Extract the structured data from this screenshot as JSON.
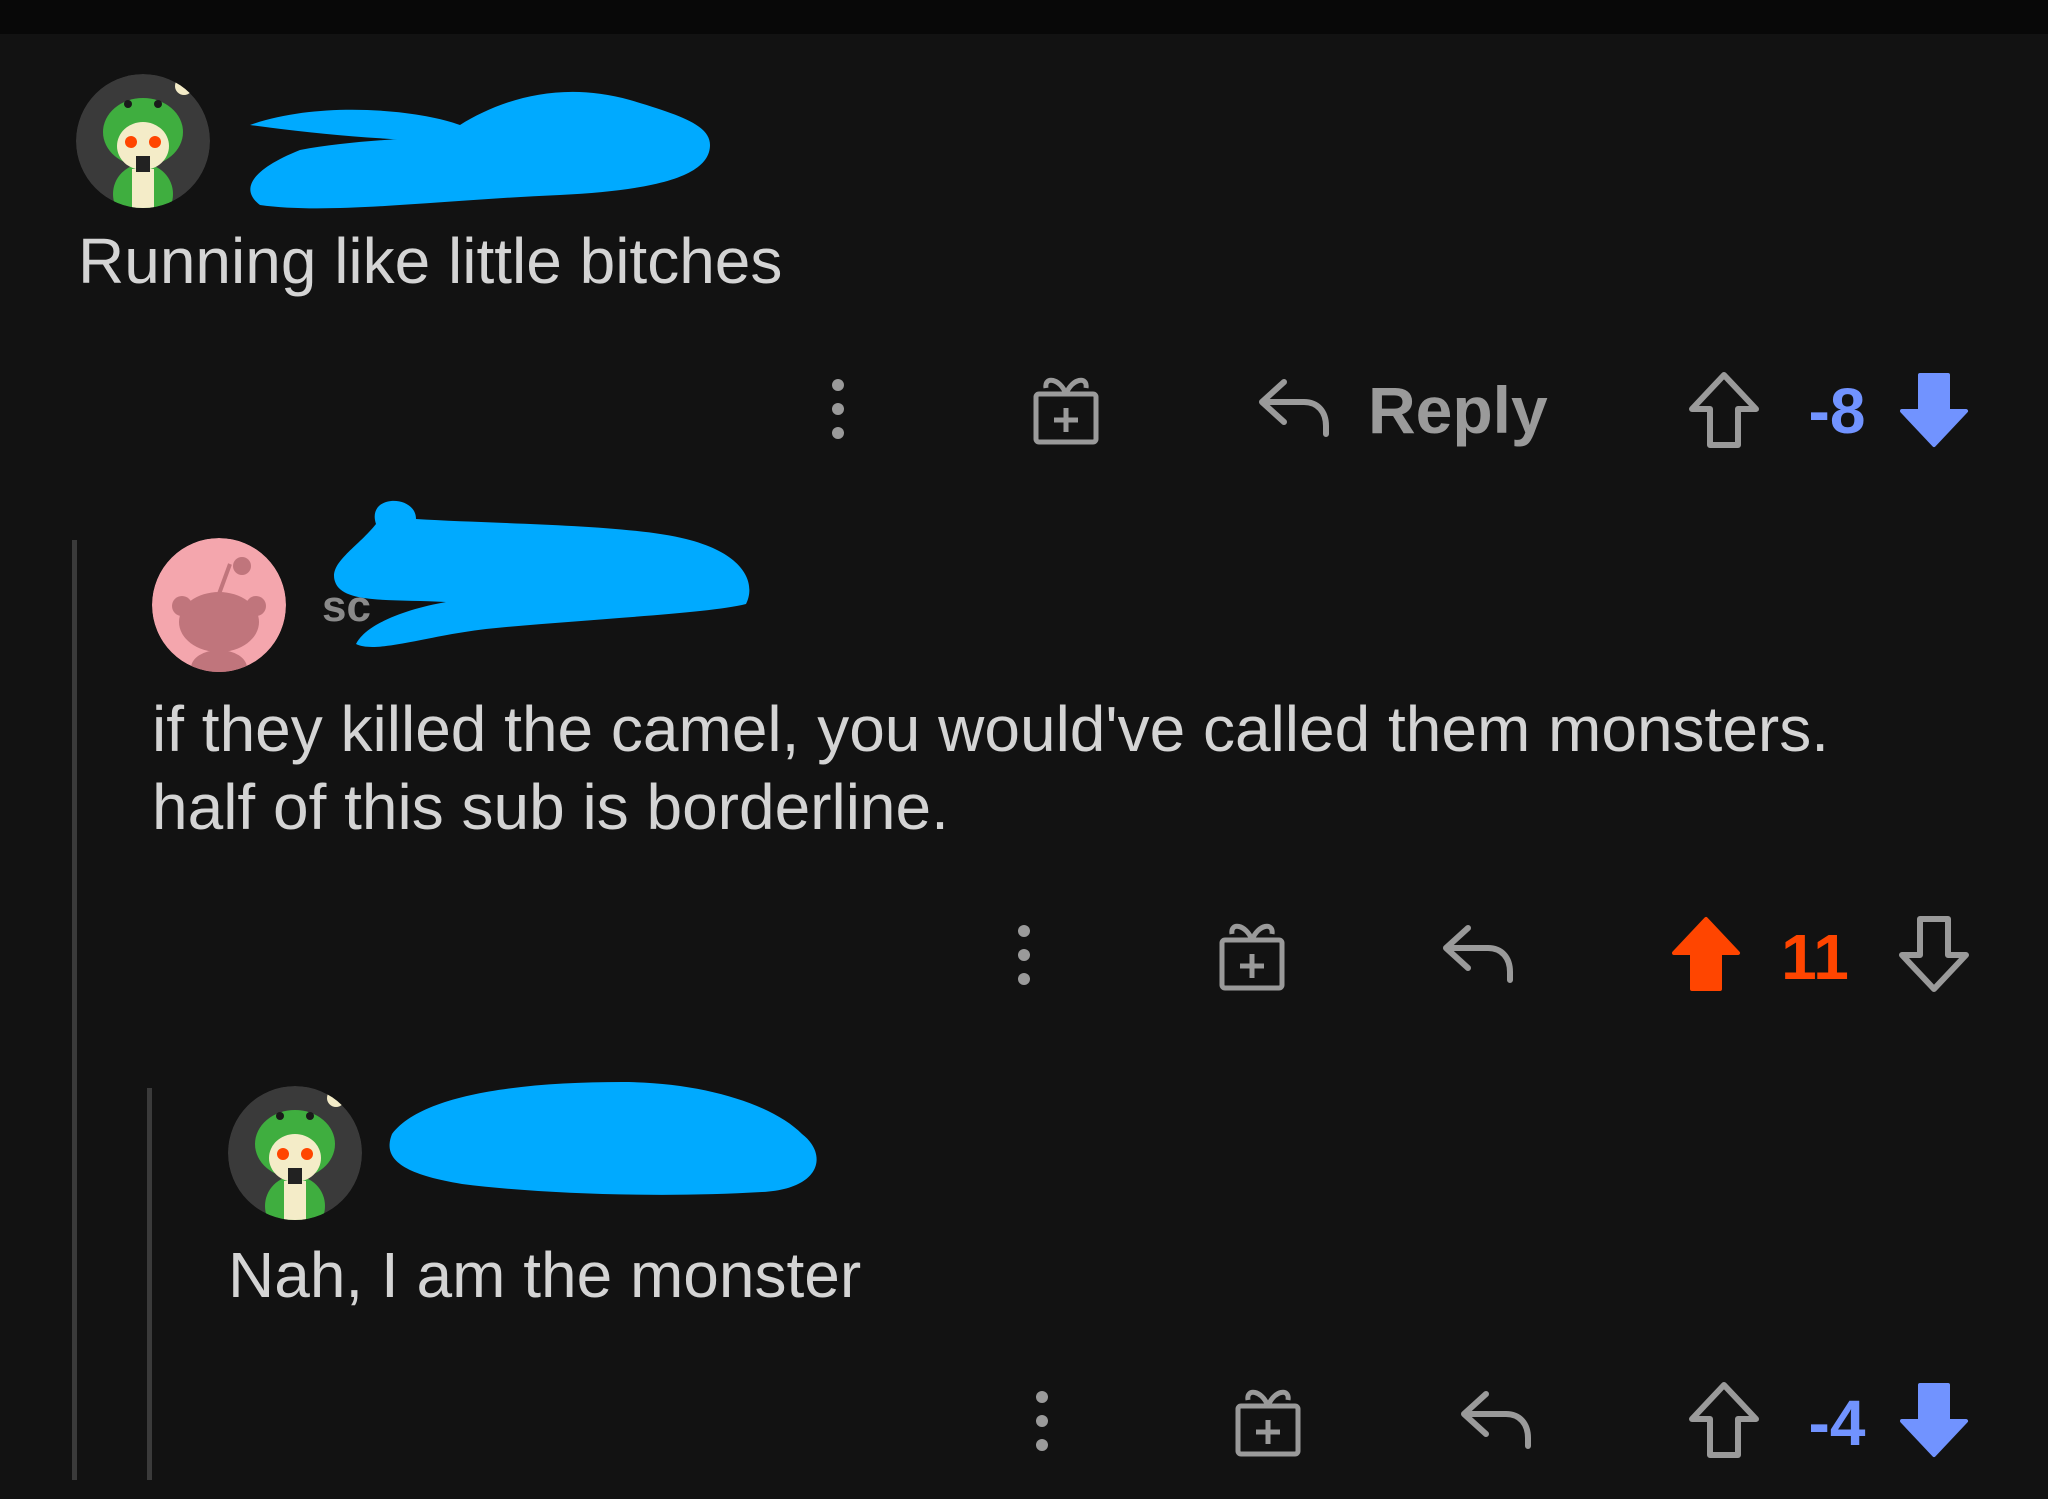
{
  "colors": {
    "background": "#121212",
    "text": "#d4d4d4",
    "muted": "#9a9a9a",
    "downvote": "#7193ff",
    "upvote": "#ff4500",
    "redaction": "#00aaff",
    "thread_line": "#3a3a3a"
  },
  "comments": [
    {
      "username_visible": "",
      "username_redacted": true,
      "avatar": "snoo-frog-hood-avatar",
      "body": "Running like little bitches",
      "actions": {
        "more_icon": "more-vertical-icon",
        "award_icon": "award-gift-icon",
        "reply_icon": "reply-arrow-icon",
        "reply_label": "Reply",
        "score": "-8",
        "vote_state": "downvoted"
      }
    },
    {
      "username_visible": "sc",
      "username_redacted": true,
      "avatar": "default-snoo-pink-avatar",
      "body": "if they killed the camel, you would've called them monsters.\nhalf of this sub is borderline.",
      "actions": {
        "more_icon": "more-vertical-icon",
        "award_icon": "award-gift-icon",
        "reply_icon": "reply-arrow-icon",
        "reply_label": "",
        "score": "11",
        "vote_state": "upvoted"
      }
    },
    {
      "username_visible": "",
      "username_redacted": true,
      "avatar": "snoo-frog-hood-avatar",
      "body": "Nah, I am the monster",
      "actions": {
        "more_icon": "more-vertical-icon",
        "award_icon": "award-gift-icon",
        "reply_icon": "reply-arrow-icon",
        "reply_label": "",
        "score": "-4",
        "vote_state": "downvoted"
      }
    }
  ]
}
